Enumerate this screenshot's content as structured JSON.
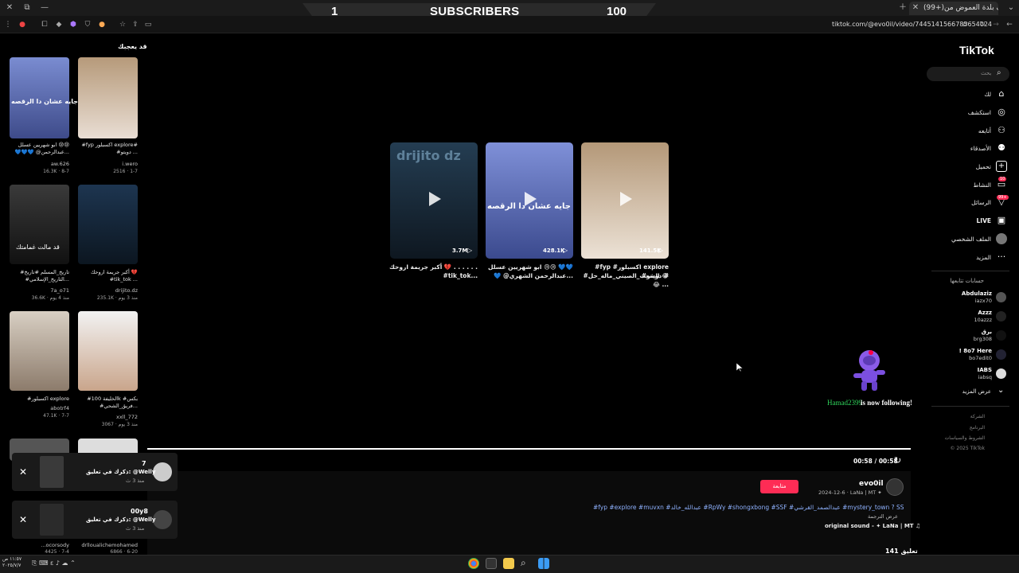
{
  "window": {
    "tab_title": "(99+)اكتشاف بلدة العموض من...",
    "url": "tiktok.com/@evo0il/video/7445141566785654024"
  },
  "overlay": {
    "left_number": "1",
    "title": "SUBSCRIBERS",
    "right_number": "100"
  },
  "left_grid": {
    "title": "قد يعجبك",
    "items": [
      {
        "caption": "#fyp اكسبلور explore#",
        "caption2": "#دويتو ...",
        "user": "i.wero",
        "stat": "2516 · 1-7"
      },
      {
        "caption": "ابو شهريين عسلل 😢😢",
        "caption2": "💙💙💙 @عبدالرحمن...",
        "user": "aw.626",
        "stat": "16.3K · 8-7"
      },
      {
        "caption": "أكبر جريمة اروحك 💔",
        "caption2": "#tik_tok ...",
        "user": "drijito.dz",
        "stat": "235.1K · منذ 3 يوم"
      },
      {
        "caption": "#تاريخ_المسلم #تاريخ",
        "caption2": "#التاريخ_الإسلامي...",
        "user": "7a_o71",
        "stat": "36.6K · منذ 4 يوم"
      },
      {
        "caption": "#الخليفة 100k #بكس",
        "caption2": "#فريق_الشحي...",
        "user": "xxll_772",
        "stat": "3067 · منذ 3 يوم"
      },
      {
        "caption": "#اكسبلور explore",
        "caption2": "",
        "user": "abotrf4",
        "stat": "47.1K · 7-7"
      },
      {
        "caption": "",
        "caption2": "",
        "user": "drlloualichemohamed",
        "stat": "6866 · 6-20"
      },
      {
        "caption": "",
        "caption2": "",
        "user": "...ocorsody",
        "stat": "4425 · 7-4"
      }
    ]
  },
  "cards": [
    {
      "count": "3.7M",
      "caption": "أكبر جريمة اروحك 💔 . . . . . . .",
      "caption2": "#tik_tok..."
    },
    {
      "count": "428.1K",
      "caption": "ابو شهريين عسلل 😢😢 💙💙",
      "caption2": "💙 @عبدالرحمن الشهري..."
    },
    {
      "count": "141.5K",
      "caption": "#fyp #اكسبلور explore #دويتو #",
      "caption2": "#الشعب_الصيني_ماله_حل 😂😂 ..."
    }
  ],
  "sidebar": {
    "logo": "TikTok",
    "search_placeholder": "بحث",
    "nav": [
      "لك",
      "استكشف",
      "أتابعه",
      "الأصدقاء",
      "تحميل",
      "النشاط",
      "الرسائل",
      "LIVE",
      "الملف الشخصي",
      "المزيد"
    ],
    "badges": {
      "activity": "10",
      "messages": "99+"
    },
    "following_title": "حسابات تتابعها",
    "following": [
      {
        "name": "Abdulaziz",
        "user": "iazx70"
      },
      {
        "name": "Azzz",
        "user": "10azzz"
      },
      {
        "name": "برق",
        "user": "brg308"
      },
      {
        "name": "! 8o7 Here",
        "user": "bo7edit0"
      },
      {
        "name": "IABS",
        "user": "iabsq"
      }
    ],
    "see_more": "عرض المزيد",
    "footer": [
      "الشركة",
      "البرنامج",
      "الشروط والسياسات",
      "© 2025 TikTok"
    ]
  },
  "player": {
    "time": "00:58 / 00:58",
    "author": "evo0il",
    "meta": "2024-12-6 · LaNa | MT ✦",
    "follow": "متابعة",
    "description": "#fyp #explore #muvxn #عبدالله_خالد #RpWy #shongxbong #SSF #عبدالصمد_القرشي #mystery_town ? SSF - F-0",
    "translate": "عرض الترجمة",
    "sound": "original sound - ✦ LaNa | MT ♫",
    "comments": "141 تعليق"
  },
  "notifications": [
    {
      "title": "7",
      "text": "ذكرك في تعليق: @Welly",
      "time": "منذ 3 ث"
    },
    {
      "title": "00y8",
      "text": "ذكرك في تعليق: @Welly",
      "time": "منذ 3 ث"
    }
  ],
  "toast": {
    "user": "Hamad2399",
    "text": "is now following!"
  },
  "taskbar": {
    "clock_time": "١١:٥٧ ص",
    "clock_date": "٢٠٢٥/٧/٧"
  }
}
